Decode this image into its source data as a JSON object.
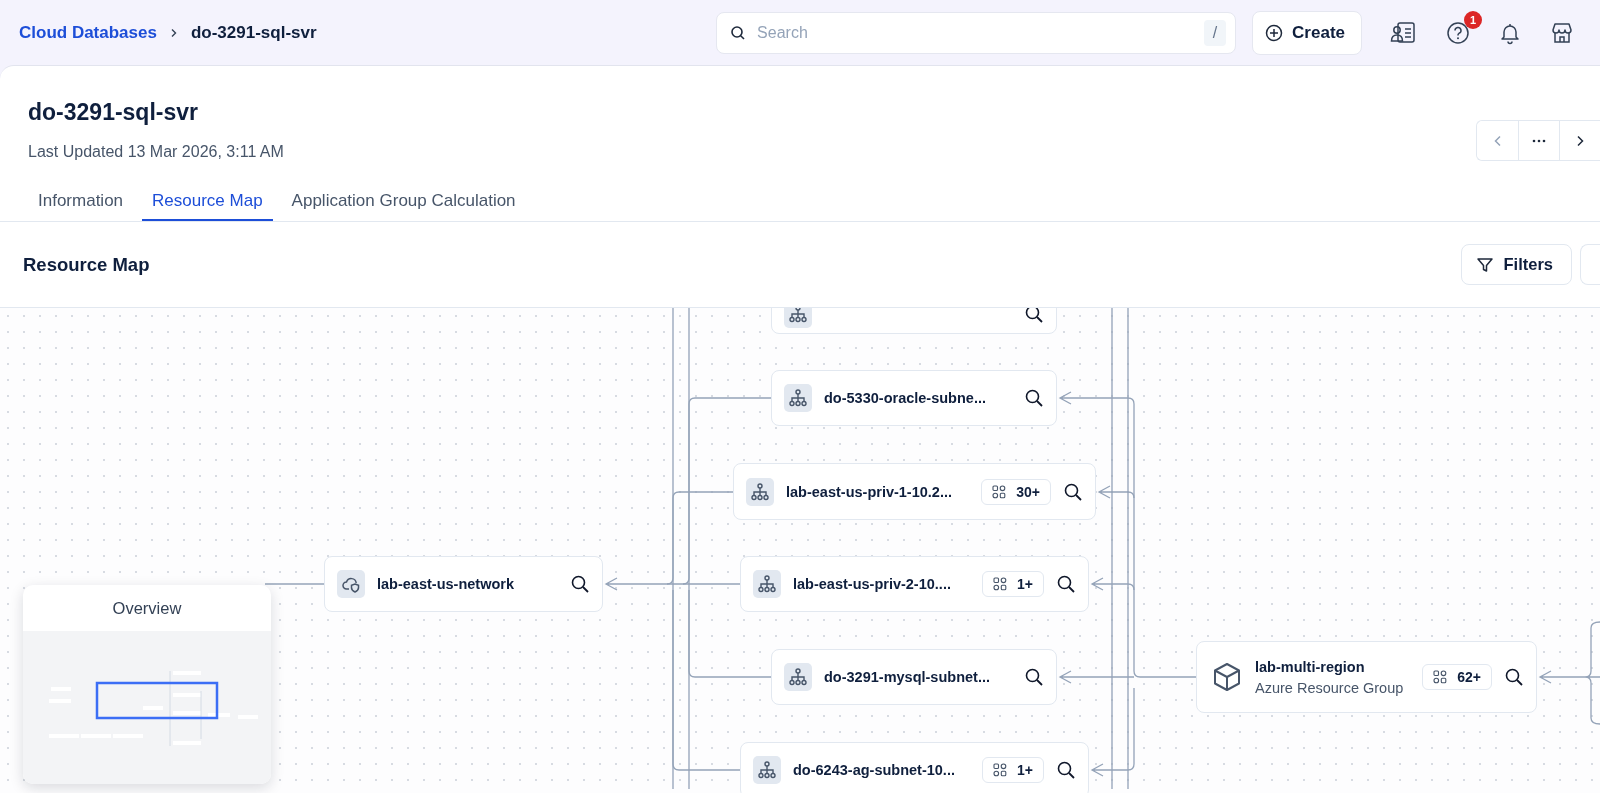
{
  "breadcrumb": {
    "parent": "Cloud Databases",
    "current": "do-3291-sql-svr"
  },
  "search": {
    "placeholder": "Search",
    "shortcut": "/"
  },
  "create_button": "Create",
  "notifications": {
    "badge": "1"
  },
  "page": {
    "title": "do-3291-sql-svr",
    "subtitle": "Last Updated 13 Mar 2026, 3:11 AM"
  },
  "tabs": [
    {
      "label": "Information",
      "selected": false
    },
    {
      "label": "Resource Map",
      "selected": true
    },
    {
      "label": "Application Group Calculation",
      "selected": false
    }
  ],
  "section": {
    "title": "Resource Map",
    "filters": "Filters"
  },
  "nodes": [
    {
      "kind": "subnet"
    },
    {
      "kind": "subnet",
      "label": "do-5330-oracle-subne..."
    },
    {
      "kind": "subnet",
      "label": "lab-east-us-priv-1-10.2...",
      "count": "30+"
    },
    {
      "kind": "network",
      "label": "lab-east-us-network"
    },
    {
      "kind": "subnet",
      "label": "lab-east-us-priv-2-10....",
      "count": "1+"
    },
    {
      "kind": "subnet",
      "label": "do-3291-mysql-subnet..."
    },
    {
      "kind": "group",
      "label": "lab-multi-region",
      "sub": "Azure Resource Group",
      "count": "62+"
    },
    {
      "kind": "subnet",
      "label": "do-6243-ag-subnet-10...",
      "count": "1+"
    }
  ],
  "overview": {
    "title": "Overview"
  }
}
